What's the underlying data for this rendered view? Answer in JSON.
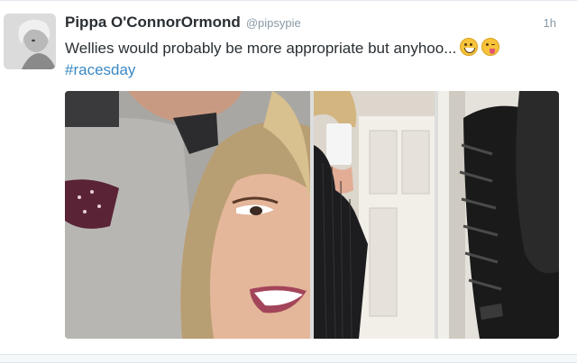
{
  "tweet": {
    "display_name": "Pippa O'ConnorOrmond",
    "handle": "@pipsypie",
    "timestamp": "1h",
    "text": "Wellies would probably be more appropriate but anyhoo...",
    "emojis": [
      "grinning-face-emoji",
      "winking-face-tongue-emoji"
    ],
    "hashtag": "#racesday"
  },
  "colors": {
    "name": "#292f33",
    "meta": "#8899a6",
    "link": "#3b88c3",
    "border": "#e1e8ed"
  },
  "media": {
    "photos": [
      "selfie-photo",
      "mirror-selfie-photo",
      "black-jacket-photo"
    ]
  }
}
